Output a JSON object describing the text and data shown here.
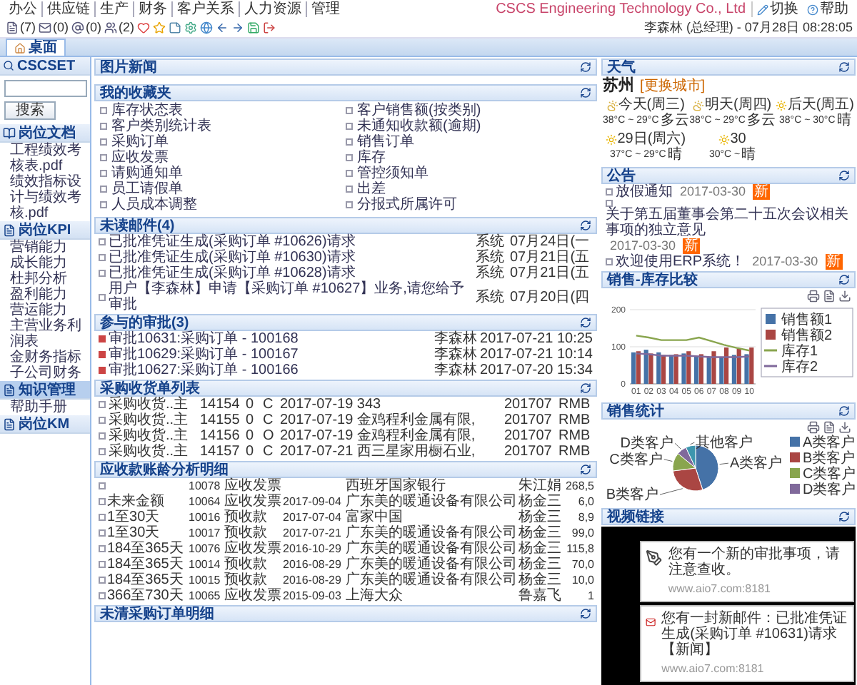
{
  "menu": [
    "办公",
    "供应链",
    "生产",
    "财务",
    "客户关系",
    "人力资源",
    "管理"
  ],
  "company": "CSCS Engineering Technology Co., Ltd",
  "header_links": [
    {
      "kind": "switch",
      "label": "切换"
    },
    {
      "kind": "help",
      "label": "帮助"
    }
  ],
  "toolbar": [
    {
      "kind": "doc",
      "count": "(7)"
    },
    {
      "kind": "mail",
      "count": "(0)"
    },
    {
      "kind": "at",
      "count": "(0)"
    },
    {
      "kind": "users",
      "count": "(2)"
    },
    {
      "kind": "heart"
    },
    {
      "kind": "star"
    },
    {
      "kind": "note"
    },
    {
      "kind": "gear"
    },
    {
      "kind": "globe"
    },
    {
      "kind": "back"
    },
    {
      "kind": "forward"
    },
    {
      "kind": "save"
    },
    {
      "kind": "exit"
    }
  ],
  "user_info": "李森林 (总经理) - 07月28日 08:28:05",
  "tabs": [
    {
      "label": "桌面",
      "selected": true
    }
  ],
  "sidebar": {
    "title": "CSCSET",
    "search_button": "搜索",
    "sections": [
      {
        "kind": "book",
        "title": "岗位文档",
        "selected": false,
        "items": [
          "工程绩效考核表.pdf",
          "绩效指标设计与绩效考核.pdf"
        ]
      },
      {
        "kind": "page",
        "title": "岗位KPI",
        "selected": false,
        "items": [
          "营销能力",
          "成长能力",
          "杜邦分析",
          "盈利能力",
          "营运能力",
          "主营业务利润表",
          "金财务指标",
          "子公司财务"
        ]
      },
      {
        "kind": "page",
        "title": "知识管理",
        "selected": true,
        "items": [
          "帮助手册"
        ]
      },
      {
        "kind": "page",
        "title": "岗位KM",
        "selected": false
      }
    ]
  },
  "news": {
    "title": "图片新闻"
  },
  "favorites": {
    "title": "我的收藏夹",
    "items": [
      "库存状态表",
      "客户销售额(按类别)",
      "客户类别统计表",
      "未通知收款额(逾期)",
      "采购订单",
      "销售订单",
      "应收发票",
      "库存",
      "请购通知单",
      "管控须知单",
      "员工请假单",
      "出差",
      "人员成本调整",
      "分报式所属许可"
    ]
  },
  "mail": {
    "title": "未读邮件(4)",
    "rows": [
      {
        "subject": "已批准凭证生成(采购订单 #10626)请求",
        "sender": "系统",
        "date": "07月24日(一"
      },
      {
        "subject": "已批准凭证生成(采购订单 #10630)请求",
        "sender": "系统",
        "date": "07月21日(五"
      },
      {
        "subject": "已批准凭证生成(采购订单 #10628)请求",
        "sender": "系统",
        "date": "07月21日(五"
      },
      {
        "subject": "用户【李森林】申请【采购订单 #10627】业务,请您给予审批",
        "sender": "系统",
        "date": "07月20日(四"
      }
    ]
  },
  "approvals": {
    "title": "参与的审批(3)",
    "rows": [
      {
        "subject": "审批10631:采购订单 - 100168",
        "user": "李森林",
        "time": "2017-07-21 10:25"
      },
      {
        "subject": "审批10629:采购订单 - 100167",
        "user": "李森林",
        "time": "2017-07-21 10:14"
      },
      {
        "subject": "审批10627:采购订单 - 100166",
        "user": "李森林",
        "time": "2017-07-20 15:34"
      }
    ]
  },
  "purchases": {
    "title": "采购收货单列表",
    "rows": [
      [
        "采购收货..主",
        "14154",
        "0",
        "C",
        "2017-07-19 343",
        "201707",
        "RMB"
      ],
      [
        "采购收货..主",
        "14155",
        "0",
        "C",
        "2017-07-19 金鸡程利金属有限,",
        "201707",
        "RMB"
      ],
      [
        "采购收货..主",
        "14156",
        "0",
        "O",
        "2017-07-19 金鸡程利金属有限,",
        "201707",
        "RMB"
      ],
      [
        "采购收货..主",
        "14157",
        "0",
        "C",
        "2017-07-21 西三星家用橱石业,",
        "201707",
        "RMB"
      ]
    ]
  },
  "receivables": {
    "title": "应收款账龄分析明细",
    "rows": [
      {
        "code": "10078",
        "type": "应收发票",
        "customer": "西班牙国家银行",
        "person": "朱江娟",
        "amount": "268,5"
      },
      {
        "bucket": "未来金额",
        "code": "10064",
        "type": "应收发票",
        "date": "2017-09-04",
        "customer": "广东美的暖通设备有限公司",
        "person": "杨金三",
        "amount": "6,0"
      },
      {
        "bucket": "1至30天",
        "code": "10016",
        "type": "预收款",
        "date": "2017-07-04",
        "customer": "富家中国",
        "person": "杨金三",
        "amount": "8,9"
      },
      {
        "bucket": "1至30天",
        "code": "10017",
        "type": "预收款",
        "date": "2017-07-21",
        "customer": "广东美的暖通设备有限公司",
        "person": "杨金三",
        "amount": "99,0"
      },
      {
        "bucket": "184至365天",
        "code": "10076",
        "type": "应收发票",
        "date": "2016-10-29",
        "customer": "广东美的暖通设备有限公司",
        "person": "杨金三",
        "amount": "115,8"
      },
      {
        "bucket": "184至365天",
        "code": "10014",
        "type": "预收款",
        "date": "2016-08-29",
        "customer": "广东美的暖通设备有限公司",
        "person": "杨金三",
        "amount": "70,0"
      },
      {
        "bucket": "184至365天",
        "code": "10015",
        "type": "预收款",
        "date": "2016-08-29",
        "customer": "广东美的暖通设备有限公司",
        "person": "杨金三",
        "amount": "10,0"
      },
      {
        "bucket": "366至730天",
        "code": "10065",
        "type": "应收发票",
        "date": "2015-09-03",
        "customer": "上海大众",
        "person": "鲁嘉飞",
        "amount": "1"
      }
    ]
  },
  "open_orders": {
    "title": "未清采购订单明细"
  },
  "weather": {
    "title": "天气",
    "city": "苏州",
    "change_city": "[更换城市]",
    "days": [
      {
        "kind": "cloudy",
        "label": "今天(周三)",
        "temp": "38°C ~ 29°C",
        "cond": "多云"
      },
      {
        "kind": "cloudy",
        "label": "明天(周四)",
        "temp": "38°C ~ 29°C",
        "cond": "多云"
      },
      {
        "kind": "sunny",
        "label": "后天(周五)",
        "temp": "38°C ~ 30°C",
        "cond": "晴"
      },
      {
        "kind": "sunny",
        "label": "29日(周六)",
        "temp": "37°C ~ 29°C",
        "cond": "晴"
      },
      {
        "kind": "sunny",
        "label": "30",
        "temp": "30°C ~",
        "cond": "晴"
      }
    ]
  },
  "notices": {
    "title": "公告",
    "items": [
      {
        "text": "放假通知",
        "date": "2017-03-30",
        "badge": "新"
      },
      {
        "text": "关于第五届董事会第二十五次会议相关事项的独立意见",
        "date": "2017-03-30",
        "badge": "新"
      },
      {
        "text": "欢迎使用ERP系统！",
        "date": "2017-03-30",
        "badge": "新"
      }
    ]
  },
  "sales_chart": {
    "title": "销售-库存比较",
    "chart_data": {
      "type": "bar",
      "categories": [
        "01",
        "02",
        "03",
        "04",
        "05",
        "06",
        "07",
        "08",
        "09",
        "10"
      ],
      "ylim": [
        0,
        200
      ],
      "yticks": [
        0,
        100,
        200
      ],
      "legend": "right",
      "series": [
        {
          "name": "销售额1",
          "type": "bar",
          "color": "#4572a7",
          "values": [
            85,
            92,
            85,
            78,
            82,
            75,
            72,
            72,
            78,
            80
          ]
        },
        {
          "name": "销售额2",
          "type": "bar",
          "color": "#aa4643",
          "values": [
            88,
            82,
            78,
            80,
            88,
            80,
            88,
            98,
            95,
            98
          ]
        },
        {
          "name": "库存1",
          "type": "line",
          "color": "#89a54e",
          "values": [
            130,
            125,
            118,
            118,
            118,
            125,
            115,
            105,
            97,
            90
          ]
        },
        {
          "name": "库存2",
          "type": "line",
          "color": "#80699b",
          "values": [
            82,
            80,
            76,
            76,
            76,
            74,
            72,
            72,
            72,
            74
          ]
        }
      ]
    }
  },
  "pie_chart": {
    "title": "销售统计",
    "legend": [
      "A类客户",
      "B类客户",
      "C类客户",
      "D类客户"
    ],
    "chart_data": {
      "type": "pie",
      "categories": [
        "A类客户",
        "B类客户",
        "C类客户",
        "D类客户",
        "其他客户"
      ],
      "series": [
        {
          "values": [
            45,
            28,
            13,
            7,
            7
          ]
        }
      ]
    }
  },
  "video": {
    "title": "视频链接"
  },
  "popups": [
    {
      "kind": "approval",
      "text": "您有一个新的审批事项，请注意查收。",
      "url": "www.aio7.com:8181"
    },
    {
      "kind": "mail",
      "text": "您有一封新邮件：已批准凭证生成(采购订单 #10631)请求【新闻】",
      "url": "www.aio7.com:8181"
    }
  ]
}
